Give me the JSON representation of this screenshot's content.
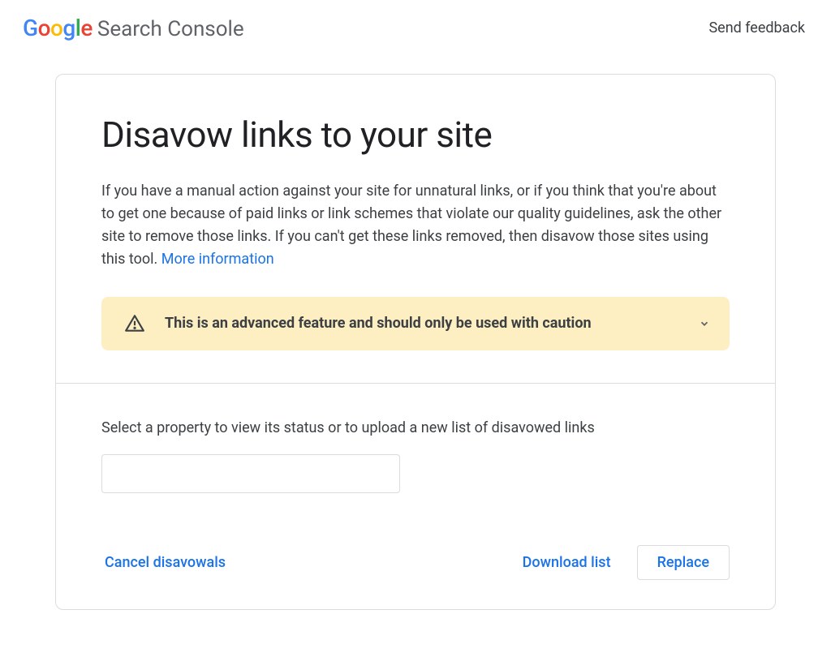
{
  "header": {
    "product_name": "Search Console",
    "feedback_label": "Send feedback"
  },
  "main": {
    "title": "Disavow links to your site",
    "description": "If you have a manual action against your site for unnatural links, or if you think that you're about to get one because of paid links or link schemes that violate our quality guidelines, ask the other site to remove those links. If you can't get these links removed, then disavow those sites using this tool. ",
    "more_info_label": "More information",
    "warning_text": "This is an advanced feature and should only be used with caution",
    "select_label": "Select a property to view its status or to upload a new list of disavowed links",
    "property_select_value": "",
    "actions": {
      "cancel_label": "Cancel disavowals",
      "download_label": "Download list",
      "replace_label": "Replace"
    }
  }
}
